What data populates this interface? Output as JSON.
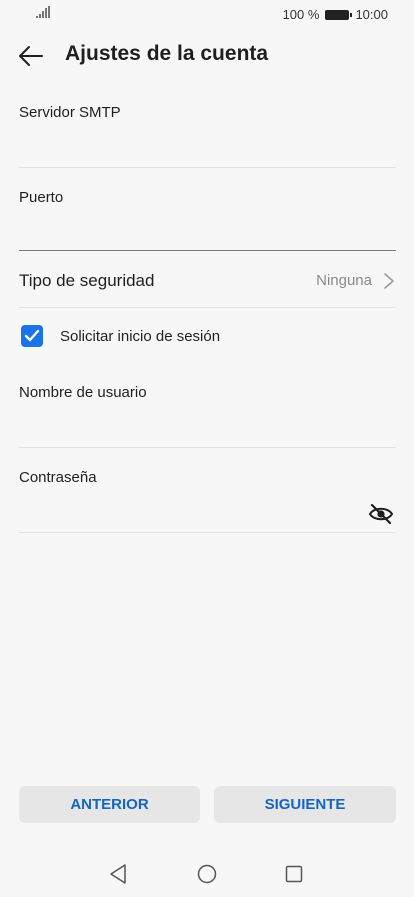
{
  "status_bar": {
    "battery_percent": "100 %",
    "time": "10:00"
  },
  "header": {
    "title": "Ajustes de la cuenta"
  },
  "fields": {
    "smtp_server": {
      "label": "Servidor SMTP",
      "value": ""
    },
    "port": {
      "label": "Puerto",
      "value": ""
    },
    "username": {
      "label": "Nombre de usuario",
      "value": ""
    },
    "password": {
      "label": "Contraseña",
      "value": ""
    }
  },
  "security": {
    "label": "Tipo de seguridad",
    "value": "Ninguna"
  },
  "login_required": {
    "label": "Solicitar inicio de sesión",
    "checked": true
  },
  "buttons": {
    "previous": "ANTERIOR",
    "next": "SIGUIENTE"
  },
  "colors": {
    "accent": "#1a73e8",
    "button_text": "#1565c0",
    "background": "#f7f7f7"
  }
}
